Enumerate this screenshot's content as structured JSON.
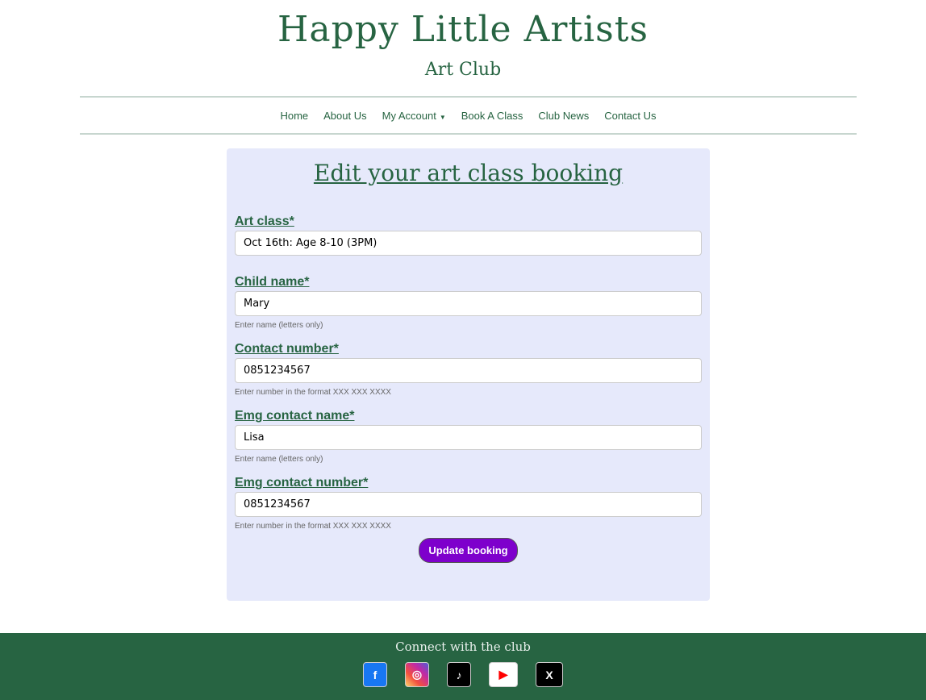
{
  "header": {
    "title": "Happy Little Artists",
    "subtitle": "Art Club"
  },
  "nav": {
    "items": [
      "Home",
      "About Us",
      "My Account",
      "Book A Class",
      "Club News",
      "Contact Us"
    ]
  },
  "form": {
    "title": "Edit your art class booking",
    "fields": [
      {
        "label": "Art class*",
        "value": "Oct 16th: Age 8-10 (3PM)",
        "help": ""
      },
      {
        "label": "Child name*",
        "value": "Mary",
        "help": "Enter name (letters only)"
      },
      {
        "label": "Contact number*",
        "value": "0851234567",
        "help": "Enter number in the format XXX XXX XXXX"
      },
      {
        "label": "Emg contact name*",
        "value": "Lisa",
        "help": "Enter name (letters only)"
      },
      {
        "label": "Emg contact number*",
        "value": "0851234567",
        "help": "Enter number in the format XXX XXX XXXX"
      }
    ],
    "submit": "Update booking"
  },
  "footer": {
    "text": "Connect with the club",
    "socials": [
      "facebook-icon",
      "instagram-icon",
      "tiktok-icon",
      "youtube-icon",
      "x-icon"
    ]
  },
  "colors": {
    "brand": "#276442",
    "card": "#e6e9fb",
    "button": "#7e00cc"
  }
}
